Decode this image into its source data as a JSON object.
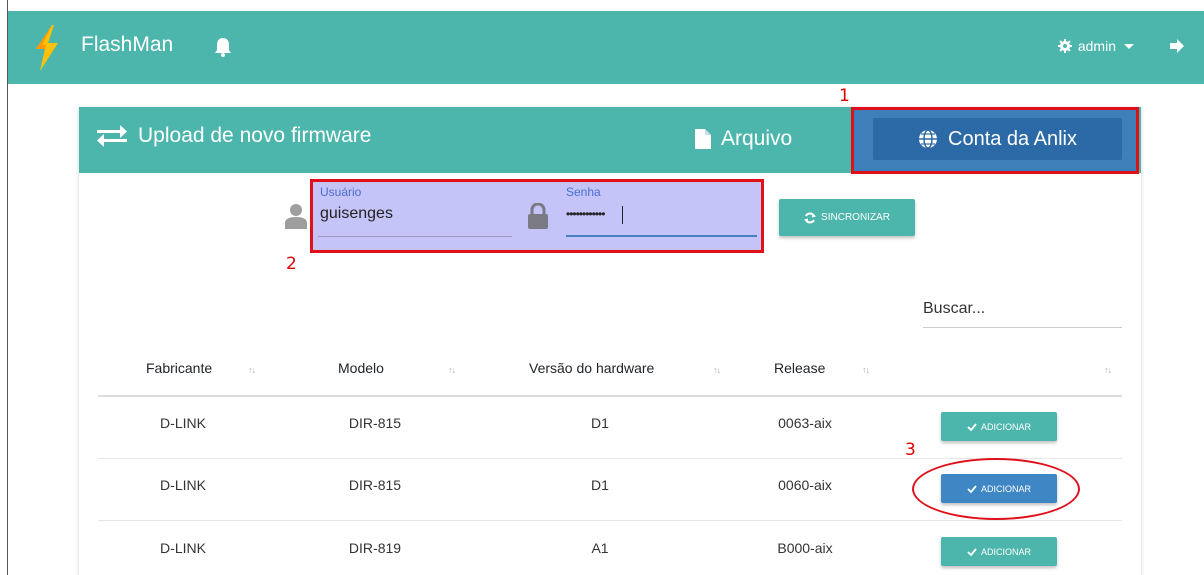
{
  "navbar": {
    "brand": "FlashMan",
    "user_menu": "admin"
  },
  "card": {
    "title": "Upload de novo firmware",
    "tab_file": "Arquivo",
    "tab_anlix": "Conta da Anlix"
  },
  "credentials": {
    "user_label": "Usuário",
    "user_value": "guisenges",
    "password_label": "Senha",
    "password_value": "••••••••••••",
    "sync_label": "SINCRONIZAR"
  },
  "search": {
    "placeholder": "Buscar..."
  },
  "table": {
    "headers": [
      "Fabricante",
      "Modelo",
      "Versão do hardware",
      "Release",
      ""
    ],
    "sort_glyph": "↑↓",
    "add_label": "ADICIONAR",
    "rows": [
      {
        "fabricante": "D-LINK",
        "modelo": "DIR-815",
        "versao": "D1",
        "release": "0063-aix"
      },
      {
        "fabricante": "D-LINK",
        "modelo": "DIR-815",
        "versao": "D1",
        "release": "0060-aix"
      },
      {
        "fabricante": "D-LINK",
        "modelo": "DIR-819",
        "versao": "A1",
        "release": "B000-aix"
      }
    ]
  },
  "annotations": [
    "1",
    "2",
    "3"
  ],
  "colors": {
    "primary": "#4db6ac",
    "anlix": "#2b6aa6",
    "annotation": "#e0101b",
    "highlight": "#c4c4f9"
  }
}
